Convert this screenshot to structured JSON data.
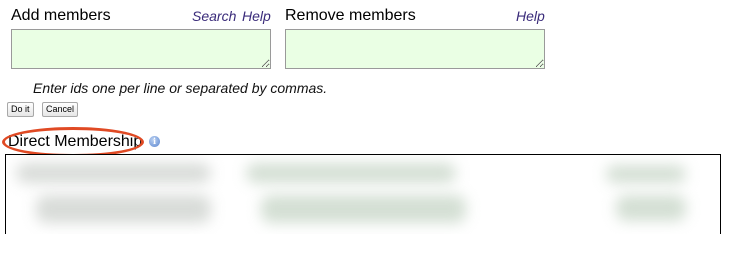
{
  "add_members": {
    "title": "Add members",
    "search_link": "Search",
    "help_link": "Help",
    "textarea_value": ""
  },
  "remove_members": {
    "title": "Remove members",
    "help_link": "Help",
    "textarea_value": ""
  },
  "hint": "Enter ids one per line or separated by commas.",
  "buttons": {
    "do_it": "Do it",
    "cancel": "Cancel"
  },
  "direct_membership": {
    "title": "Direct Membership",
    "info_icon": "info-icon"
  },
  "colors": {
    "textarea_bg": "#eaffe4",
    "link": "#3a2b7a",
    "annotation_circle": "#e04a24"
  }
}
